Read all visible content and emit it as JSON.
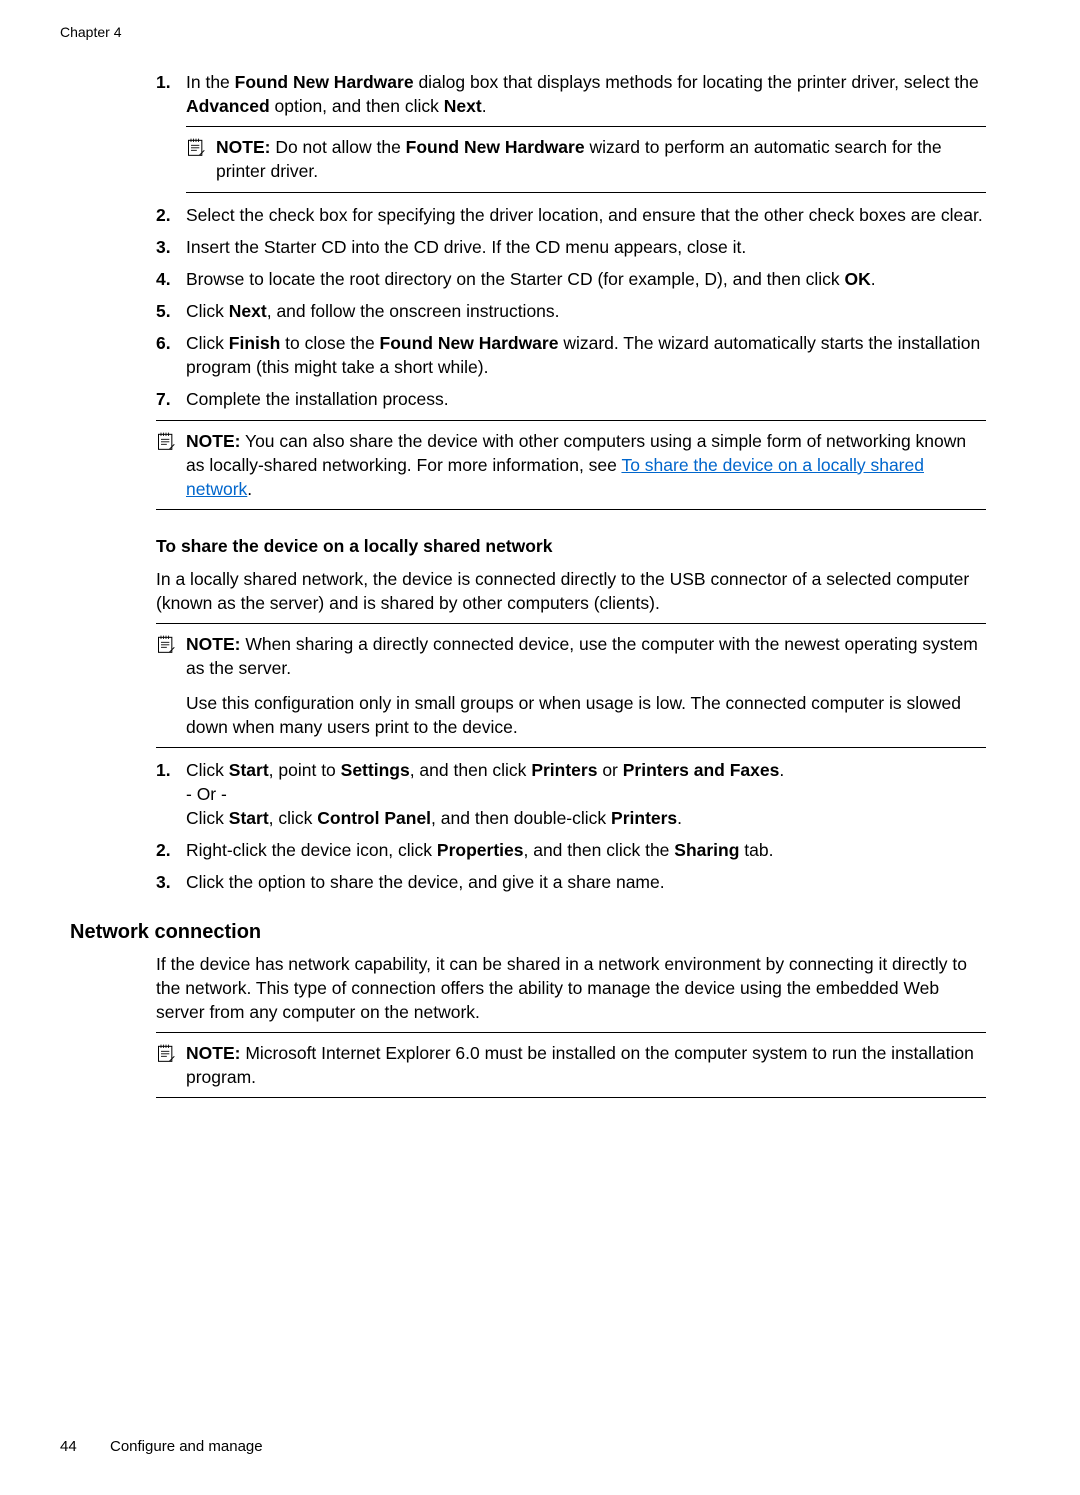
{
  "chapter": "Chapter 4",
  "steps_a": {
    "s1": {
      "num": "1.",
      "t1": "In the ",
      "b1": "Found New Hardware",
      "t2": " dialog box that displays methods for locating the printer driver, select the ",
      "b2": "Advanced",
      "t3": " option, and then click ",
      "b3": "Next",
      "t4": "."
    },
    "note1": {
      "label": "NOTE:",
      "t1": "  Do not allow the ",
      "b1": "Found New Hardware",
      "t2": " wizard to perform an automatic search for the printer driver."
    },
    "s2": {
      "num": "2.",
      "text": "Select the check box for specifying the driver location, and ensure that the other check boxes are clear."
    },
    "s3": {
      "num": "3.",
      "text": "Insert the Starter CD into the CD drive. If the CD menu appears, close it."
    },
    "s4": {
      "num": "4.",
      "t1": "Browse to locate the root directory on the Starter CD (for example, D), and then click ",
      "b1": "OK",
      "t2": "."
    },
    "s5": {
      "num": "5.",
      "t1": "Click ",
      "b1": "Next",
      "t2": ", and follow the onscreen instructions."
    },
    "s6": {
      "num": "6.",
      "t1": "Click ",
      "b1": "Finish",
      "t2": " to close the ",
      "b2": "Found New Hardware",
      "t3": " wizard. The wizard automatically starts the installation program (this might take a short while)."
    },
    "s7": {
      "num": "7.",
      "text": "Complete the installation process."
    }
  },
  "note2": {
    "label": "NOTE:",
    "t1": "  You can also share the device with other computers using a simple form of networking known as locally-shared networking. For more information, see ",
    "link": "To share the device on a locally shared network",
    "t2": "."
  },
  "sub_heading": "To share the device on a locally shared network",
  "sub_para": "In a locally shared network, the device is connected directly to the USB connector of a selected computer (known as the server) and is shared by other computers (clients).",
  "note3": {
    "label": "NOTE:",
    "p1": "  When sharing a directly connected device, use the computer with the newest operating system as the server.",
    "p2": "Use this configuration only in small groups or when usage is low. The connected computer is slowed down when many users print to the device."
  },
  "steps_b": {
    "s1": {
      "num": "1.",
      "t1": "Click ",
      "b1": "Start",
      "t2": ", point to ",
      "b2": "Settings",
      "t3": ", and then click ",
      "b3": "Printers",
      "t4": " or ",
      "b4": "Printers and Faxes",
      "t5": ".",
      "or": "- Or -",
      "t6": "Click ",
      "b5": "Start",
      "t7": ", click ",
      "b6": "Control Panel",
      "t8": ", and then double-click ",
      "b7": "Printers",
      "t9": "."
    },
    "s2": {
      "num": "2.",
      "t1": "Right-click the device icon, click ",
      "b1": "Properties",
      "t2": ", and then click the ",
      "b2": "Sharing",
      "t3": " tab."
    },
    "s3": {
      "num": "3.",
      "text": "Click the option to share the device, and give it a share name."
    }
  },
  "section_heading": "Network connection",
  "section_para": "If the device has network capability, it can be shared in a network environment by connecting it directly to the network. This type of connection offers the ability to manage the device using the embedded Web server from any computer on the network.",
  "note4": {
    "label": "NOTE:",
    "text": "  Microsoft Internet Explorer 6.0 must be installed on the computer system to run the installation program."
  },
  "footer": {
    "page": "44",
    "title": "Configure and manage"
  }
}
